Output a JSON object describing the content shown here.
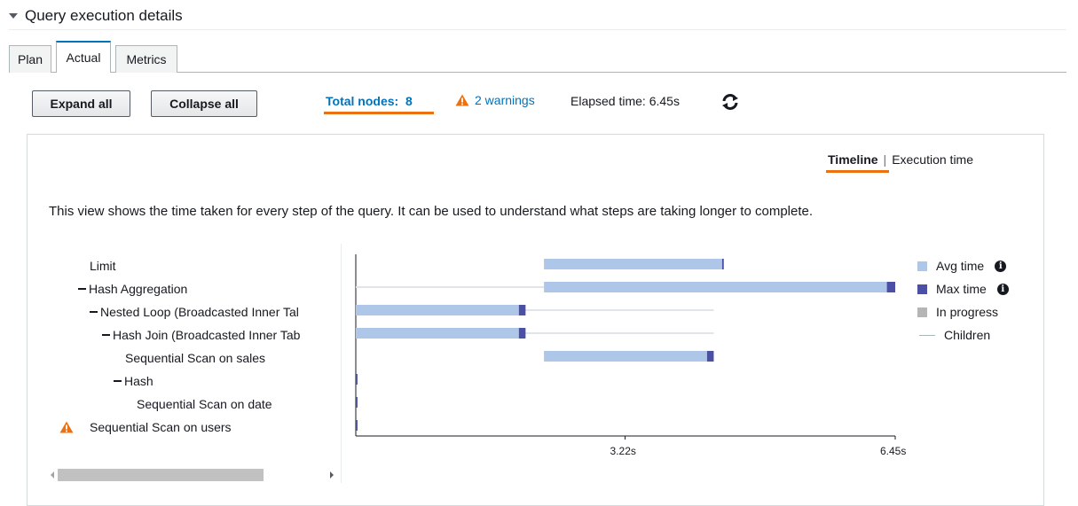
{
  "section": {
    "title": "Query execution details"
  },
  "tabs": [
    {
      "label": "Plan",
      "active": false
    },
    {
      "label": "Actual",
      "active": true
    },
    {
      "label": "Metrics",
      "active": false
    }
  ],
  "toolbar": {
    "expand_label": "Expand all",
    "collapse_label": "Collapse all",
    "total_nodes": "Total nodes:  8",
    "warnings": "2 warnings",
    "elapsed": "Elapsed time: 6.45s"
  },
  "view_toggle": {
    "active": "Timeline",
    "separator": "|",
    "other": "Execution time"
  },
  "description": "This view shows the time taken for every step of the query. It can be used to understand what steps are taking longer to complete.",
  "tree": [
    {
      "label": "Limit",
      "collapse": false,
      "warning": false
    },
    {
      "label": "Hash Aggregation",
      "collapse": true,
      "warning": false
    },
    {
      "label": "Nested Loop (Broadcasted Inner Tal",
      "collapse": true,
      "warning": false
    },
    {
      "label": "Hash Join (Broadcasted Inner Tab",
      "collapse": true,
      "warning": false
    },
    {
      "label": "Sequential Scan on sales",
      "collapse": false,
      "warning": false
    },
    {
      "label": "Hash",
      "collapse": true,
      "warning": false
    },
    {
      "label": "Sequential Scan on date",
      "collapse": false,
      "warning": false
    },
    {
      "label": "Sequential Scan on users",
      "collapse": false,
      "warning": true
    }
  ],
  "legend": [
    {
      "label": "Avg time",
      "color": "#aec7e8",
      "info": true,
      "kind": "swatch"
    },
    {
      "label": "Max time",
      "color": "#4b4fa6",
      "info": true,
      "kind": "swatch"
    },
    {
      "label": "In progress",
      "color": "#b5b5b5",
      "info": false,
      "kind": "swatch"
    },
    {
      "label": "Children",
      "color": "#d5d5d5",
      "info": false,
      "kind": "line"
    }
  ],
  "chart_data": {
    "type": "bar",
    "orientation": "horizontal-timeline",
    "categories": [
      "Limit",
      "Hash Aggregation",
      "Nested Loop (Broadcasted Inner Tal",
      "Hash Join (Broadcasted Inner Tab",
      "Sequential Scan on sales",
      "Hash",
      "Sequential Scan on date",
      "Sequential Scan on users"
    ],
    "series": [
      {
        "name": "Avg time",
        "start": [
          2.25,
          2.25,
          0.0,
          0.0,
          2.25,
          0.0,
          0.0,
          0.0
        ],
        "end": [
          4.38,
          6.35,
          1.95,
          1.95,
          4.2,
          0.02,
          0.02,
          0.02
        ]
      },
      {
        "name": "Max time",
        "start": [
          4.38,
          6.35,
          1.95,
          1.95,
          4.2,
          0.0,
          0.0,
          0.0
        ],
        "end": [
          4.4,
          6.45,
          2.03,
          2.03,
          4.28,
          0.02,
          0.02,
          0.02
        ]
      },
      {
        "name": "Children",
        "start": [
          null,
          0.0,
          1.95,
          1.95,
          null,
          null,
          null,
          null
        ],
        "end": [
          null,
          2.25,
          4.28,
          4.28,
          null,
          null,
          null,
          null
        ]
      }
    ],
    "xlim": [
      0,
      6.45
    ],
    "xticks": [
      3.22,
      6.45
    ],
    "xtick_labels": [
      "3.22s",
      "6.45s"
    ],
    "grid": false,
    "legend_position": "right"
  }
}
